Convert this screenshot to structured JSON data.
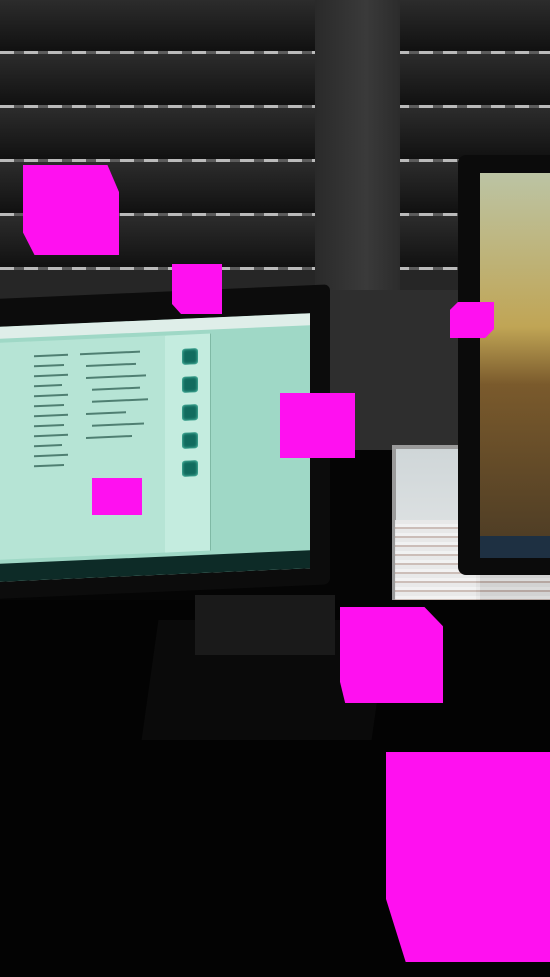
{
  "scene": {
    "description_colors": {
      "marker": "#ff10f0",
      "screen_left": "#9fd8c6",
      "blinds": "#262626"
    }
  },
  "markers": [
    {
      "name": "magenta-marker-1"
    },
    {
      "name": "magenta-marker-2"
    },
    {
      "name": "magenta-marker-3"
    },
    {
      "name": "magenta-marker-4"
    },
    {
      "name": "magenta-marker-5"
    },
    {
      "name": "magenta-marker-6"
    },
    {
      "name": "magenta-marker-7"
    }
  ]
}
